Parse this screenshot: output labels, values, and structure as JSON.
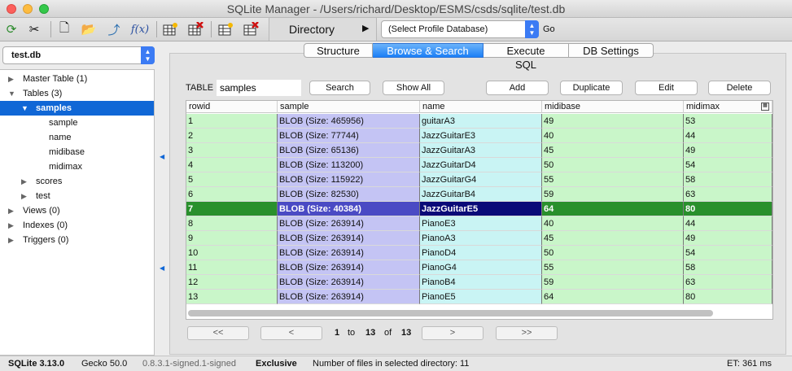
{
  "window": {
    "title": "SQLite Manager - /Users/richard/Desktop/ESMS/csds/sqlite/test.db"
  },
  "toolbar": {
    "icons": [
      "refresh-icon",
      "tools-icon",
      "new-database-icon",
      "open-database-icon",
      "attach-icon",
      "function-icon",
      "create-table-icon",
      "drop-table-icon",
      "create-index-icon",
      "drop-index-icon"
    ],
    "function_label": "f(x)",
    "directory_label": "Directory",
    "profile_select": "(Select Profile Database)",
    "go_label": "Go"
  },
  "sidebar": {
    "db_select": "test.db",
    "tree": [
      {
        "label": "Master Table (1)",
        "twisty": "▶"
      },
      {
        "label": "Tables (3)",
        "twisty": "▼"
      },
      {
        "label": "samples",
        "twisty": "▼"
      },
      {
        "label": "sample",
        "twisty": ""
      },
      {
        "label": "name",
        "twisty": ""
      },
      {
        "label": "midibase",
        "twisty": ""
      },
      {
        "label": "midimax",
        "twisty": ""
      },
      {
        "label": "scores",
        "twisty": "▶"
      },
      {
        "label": "test",
        "twisty": "▶"
      },
      {
        "label": "Views (0)",
        "twisty": "▶"
      },
      {
        "label": "Indexes (0)",
        "twisty": "▶"
      },
      {
        "label": "Triggers (0)",
        "twisty": "▶"
      }
    ]
  },
  "tabs": [
    "Structure",
    "Browse & Search",
    "Execute SQL",
    "DB Settings"
  ],
  "browse": {
    "table_label": "TABLE",
    "table_value": "samples",
    "search_button": "Search",
    "show_all_button": "Show All",
    "add_button": "Add",
    "duplicate_button": "Duplicate",
    "edit_button": "Edit",
    "delete_button": "Delete",
    "columns": [
      "rowid",
      "sample",
      "name",
      "midibase",
      "midimax"
    ],
    "rows": [
      [
        "1",
        "BLOB (Size: 465956)",
        "guitarA3",
        "49",
        "53"
      ],
      [
        "2",
        "BLOB (Size: 77744)",
        "JazzGuitarE3",
        "40",
        "44"
      ],
      [
        "3",
        "BLOB (Size: 65136)",
        "JazzGuitarA3",
        "45",
        "49"
      ],
      [
        "4",
        "BLOB (Size: 113200)",
        "JazzGuitarD4",
        "50",
        "54"
      ],
      [
        "5",
        "BLOB (Size: 115922)",
        "JazzGuitarG4",
        "55",
        "58"
      ],
      [
        "6",
        "BLOB (Size: 82530)",
        "JazzGuitarB4",
        "59",
        "63"
      ],
      [
        "7",
        "BLOB (Size: 40384)",
        "JazzGuitarE5",
        "64",
        "80"
      ],
      [
        "8",
        "BLOB (Size: 263914)",
        "PianoE3",
        "40",
        "44"
      ],
      [
        "9",
        "BLOB (Size: 263914)",
        "PianoA3",
        "45",
        "49"
      ],
      [
        "10",
        "BLOB (Size: 263914)",
        "PianoD4",
        "50",
        "54"
      ],
      [
        "11",
        "BLOB (Size: 263914)",
        "PianoG4",
        "55",
        "58"
      ],
      [
        "12",
        "BLOB (Size: 263914)",
        "PianoB4",
        "59",
        "63"
      ],
      [
        "13",
        "BLOB (Size: 263914)",
        "PianoE5",
        "64",
        "80"
      ]
    ],
    "selected_row": 7
  },
  "pager": {
    "first": "<<",
    "prev": "<",
    "next": ">",
    "last": ">>",
    "from": "1",
    "to_label": "to",
    "to": "13",
    "of_label": "of",
    "total": "13"
  },
  "status": {
    "sqlite_version": "SQLite 3.13.0",
    "gecko_version": "Gecko 50.0",
    "ext_version": "0.8.3.1-signed.1-signed",
    "lock_mode": "Exclusive",
    "files_info": "Number of files in selected directory: 11",
    "elapsed": "ET: 361 ms"
  }
}
